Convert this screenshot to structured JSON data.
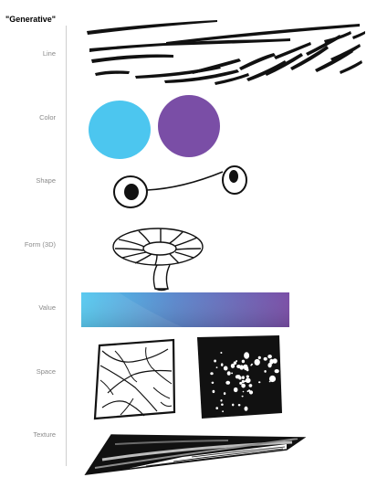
{
  "title": "\"Generative\"",
  "rows": [
    {
      "label": "Line"
    },
    {
      "label": "Color"
    },
    {
      "label": "Shape"
    },
    {
      "label": "Form (3D)"
    },
    {
      "label": "Value"
    },
    {
      "label": "Space"
    },
    {
      "label": "Texture"
    }
  ],
  "colors": {
    "blue": "#4cc6ef",
    "purple": "#7a4ea6",
    "ink": "#111111",
    "rule": "#cfcfcf",
    "label": "#8a8a8a"
  }
}
